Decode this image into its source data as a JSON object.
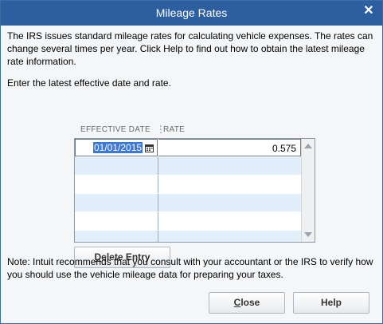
{
  "window": {
    "title": "Mileage Rates"
  },
  "intro_text": "The IRS issues standard mileage rates for calculating vehicle expenses.  The rates can change several times per year.  Click Help to find out how to obtain the latest mileage rate information.",
  "prompt_text": "Enter the latest effective date and rate.",
  "table": {
    "columns": [
      "EFFECTIVE DATE",
      "RATE"
    ],
    "rows": [
      {
        "effective_date": "01/01/2015",
        "rate": "0.575"
      }
    ]
  },
  "buttons": {
    "delete_entry": {
      "prefix": "",
      "accel": "D",
      "rest": "elete Entry"
    },
    "close": {
      "prefix": "",
      "accel": "C",
      "rest": "lose"
    },
    "help": "Help"
  },
  "note_text": "Note: Intuit recommends that you consult with your accountant or the IRS to verify how you should use the vehicle mileage data for preparing your taxes.",
  "icons": {
    "close": "close-icon",
    "calendar": "calendar-icon",
    "scroll_up": "scroll-up-icon",
    "scroll_down": "scroll-down-icon"
  },
  "colors": {
    "titlebar": "#2d5fa0",
    "selection": "#3c78d8",
    "row_alt": "#e3eefb"
  }
}
